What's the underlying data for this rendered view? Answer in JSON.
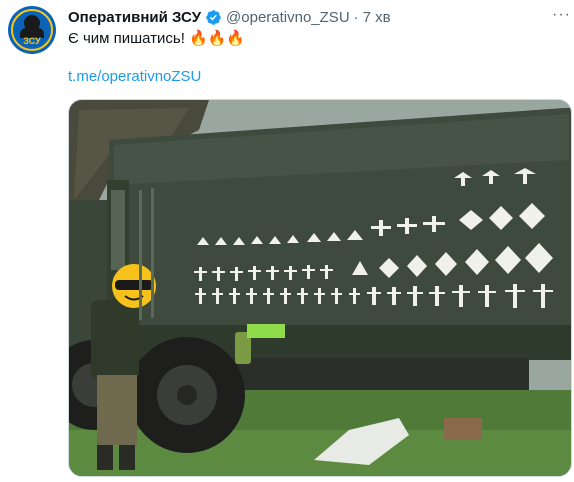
{
  "account": {
    "name": "Оперативний ЗСУ",
    "handle": "@operativno_ZSU",
    "separator": "·",
    "time": "7 хв",
    "avatar_text": "ЗСУ",
    "verified_icon": "verified-badge-icon"
  },
  "tweet": {
    "text": "Є чим пишатись! 🔥🔥🔥",
    "link": "t.me/operativnoZSU"
  },
  "menu": {
    "more_label": "···"
  },
  "media": {
    "alt_subject": "photo"
  },
  "colors": {
    "link": "#1d9bf0",
    "verified": "#1d9bf0",
    "secondary_text": "#536471"
  }
}
